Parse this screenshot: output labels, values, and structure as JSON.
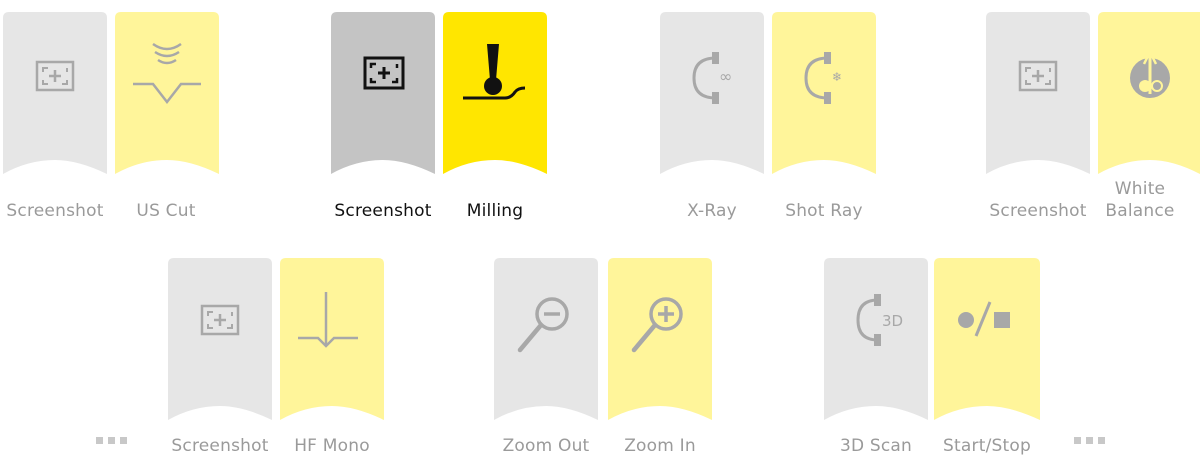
{
  "colors": {
    "gray_light": "#e6e6e6",
    "yellow_light": "#fff59a",
    "gray_active": "#c4c4c4",
    "yellow_active": "#ffe600",
    "icon_muted": "#a8a8a8",
    "icon_active": "#111111"
  },
  "groups": [
    {
      "left": {
        "label": "Screenshot",
        "icon": "screenshot-icon"
      },
      "right": {
        "label": "US Cut",
        "icon": "ultrasound-cut-icon"
      }
    },
    {
      "left": {
        "label": "Screenshot",
        "icon": "screenshot-icon"
      },
      "right": {
        "label": "Milling",
        "icon": "milling-icon"
      },
      "active": true
    },
    {
      "left": {
        "label": "X-Ray",
        "icon": "xray-icon"
      },
      "right": {
        "label": "Shot Ray",
        "icon": "shot-ray-icon"
      }
    },
    {
      "left": {
        "label": "Screenshot",
        "icon": "screenshot-icon"
      },
      "right": {
        "label": "White\nBalance",
        "icon": "white-balance-icon"
      }
    },
    {
      "left": {
        "label": "Screenshot",
        "icon": "screenshot-icon"
      },
      "right": {
        "label": "HF Mono",
        "icon": "hf-mono-icon"
      }
    },
    {
      "left": {
        "label": "Zoom Out",
        "icon": "zoom-out-icon"
      },
      "right": {
        "label": "Zoom In",
        "icon": "zoom-in-icon"
      }
    },
    {
      "left": {
        "label": "3D Scan",
        "icon": "3d-scan-icon",
        "badge": "3D"
      },
      "right": {
        "label": "Start/Stop",
        "icon": "start-stop-icon"
      }
    }
  ],
  "more_indicators": [
    "more-left",
    "more-right"
  ]
}
